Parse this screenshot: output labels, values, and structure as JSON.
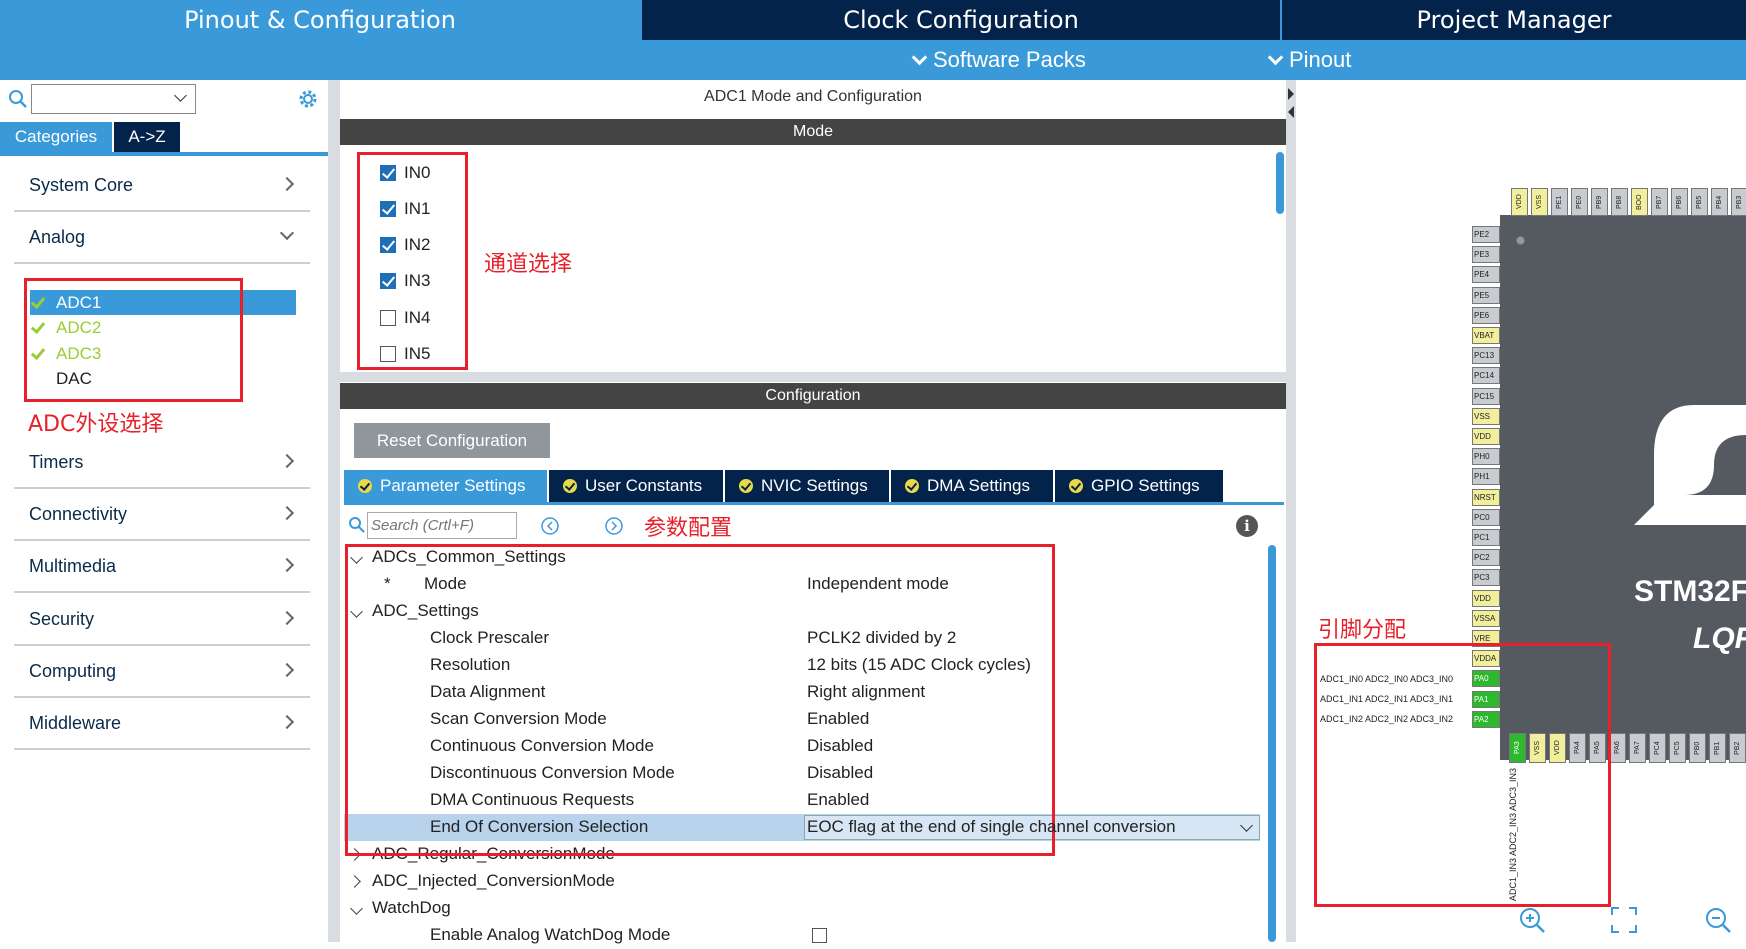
{
  "tabs": {
    "pinout": "Pinout & Configuration",
    "clock": "Clock Configuration",
    "project": "Project Manager"
  },
  "subnav": {
    "software_packs": "Software Packs",
    "pinout": "Pinout"
  },
  "left": {
    "categories_tab": "Categories",
    "az_tab": "A->Z",
    "categories": [
      "System Core",
      "Analog",
      "Timers",
      "Connectivity",
      "Multimedia",
      "Security",
      "Computing",
      "Middleware"
    ],
    "analog_items": [
      {
        "label": "ADC1",
        "checked": true,
        "selected": true
      },
      {
        "label": "ADC2",
        "checked": true,
        "selected": false
      },
      {
        "label": "ADC3",
        "checked": true,
        "selected": false
      },
      {
        "label": "DAC",
        "checked": false,
        "selected": false
      }
    ],
    "annotation": "ADC外设选择"
  },
  "middle": {
    "title": "ADC1 Mode and Configuration",
    "mode_header": "Mode",
    "channels": [
      {
        "label": "IN0",
        "checked": true
      },
      {
        "label": "IN1",
        "checked": true
      },
      {
        "label": "IN2",
        "checked": true
      },
      {
        "label": "IN3",
        "checked": true
      },
      {
        "label": "IN4",
        "checked": false
      },
      {
        "label": "IN5",
        "checked": false
      }
    ],
    "channel_annotation": "通道选择",
    "config_header": "Configuration",
    "reset_button": "Reset Configuration",
    "param_tabs": [
      "Parameter Settings",
      "User Constants",
      "NVIC Settings",
      "DMA Settings",
      "GPIO Settings"
    ],
    "search_placeholder": "Search (Crtl+F)",
    "param_annotation": "参数配置",
    "params": [
      {
        "key": "ADCs_Common_Settings",
        "value": "",
        "kind": "group-open"
      },
      {
        "key": "Mode",
        "value": "Independent mode",
        "kind": "star"
      },
      {
        "key": "ADC_Settings",
        "value": "",
        "kind": "group-open"
      },
      {
        "key": "Clock Prescaler",
        "value": "PCLK2 divided by 2",
        "kind": "item"
      },
      {
        "key": "Resolution",
        "value": "12 bits (15 ADC Clock cycles)",
        "kind": "item"
      },
      {
        "key": "Data Alignment",
        "value": "Right alignment",
        "kind": "item"
      },
      {
        "key": "Scan Conversion Mode",
        "value": "Enabled",
        "kind": "item"
      },
      {
        "key": "Continuous Conversion Mode",
        "value": "Disabled",
        "kind": "item"
      },
      {
        "key": "Discontinuous Conversion Mode",
        "value": "Disabled",
        "kind": "item"
      },
      {
        "key": "DMA Continuous Requests",
        "value": "Enabled",
        "kind": "item"
      },
      {
        "key": "End Of Conversion Selection",
        "value": "EOC flag at the end of single channel conversion",
        "kind": "selected"
      },
      {
        "key": "ADC_Regular_ConversionMode",
        "value": "",
        "kind": "group-closed"
      },
      {
        "key": "ADC_Injected_ConversionMode",
        "value": "",
        "kind": "group-closed"
      },
      {
        "key": "WatchDog",
        "value": "",
        "kind": "group-open"
      },
      {
        "key": "Enable Analog WatchDog Mode",
        "value": "",
        "kind": "checkbox"
      }
    ]
  },
  "right": {
    "chip_name": "STM32F",
    "chip_pkg": "LQF",
    "annotation": "引脚分配",
    "left_pins": [
      "PE2",
      "PE3",
      "PE4",
      "PE5",
      "PE6",
      "VBAT",
      "PC13",
      "PC14",
      "PC15",
      "VSS",
      "VDD",
      "PH0",
      "PH1",
      "NRST",
      "PC0",
      "PC1",
      "PC2",
      "PC3",
      "VDD",
      "VSSA",
      "VRE",
      "VDDA",
      "PA0",
      "PA1",
      "PA2"
    ],
    "top_pins": [
      "VDD",
      "VSS",
      "PE1",
      "PE0",
      "PB9",
      "PB8",
      "BOO",
      "PB7",
      "PB6",
      "PB5",
      "PB4",
      "PB3"
    ],
    "bottom_pins": [
      "PA3",
      "VSS",
      "VDD",
      "PA4",
      "PA5",
      "PA6",
      "PA7",
      "PC4",
      "PC5",
      "PB0",
      "PB1",
      "PB2"
    ],
    "pin_labels": [
      "ADC1_IN0 ADC2_IN0 ADC3_IN0",
      "ADC1_IN1 ADC2_IN1 ADC3_IN1",
      "ADC1_IN2 ADC2_IN2 ADC3_IN2"
    ],
    "bottom_label": "ADC1_IN3 ADC2_IN3 ADC3_IN3"
  }
}
